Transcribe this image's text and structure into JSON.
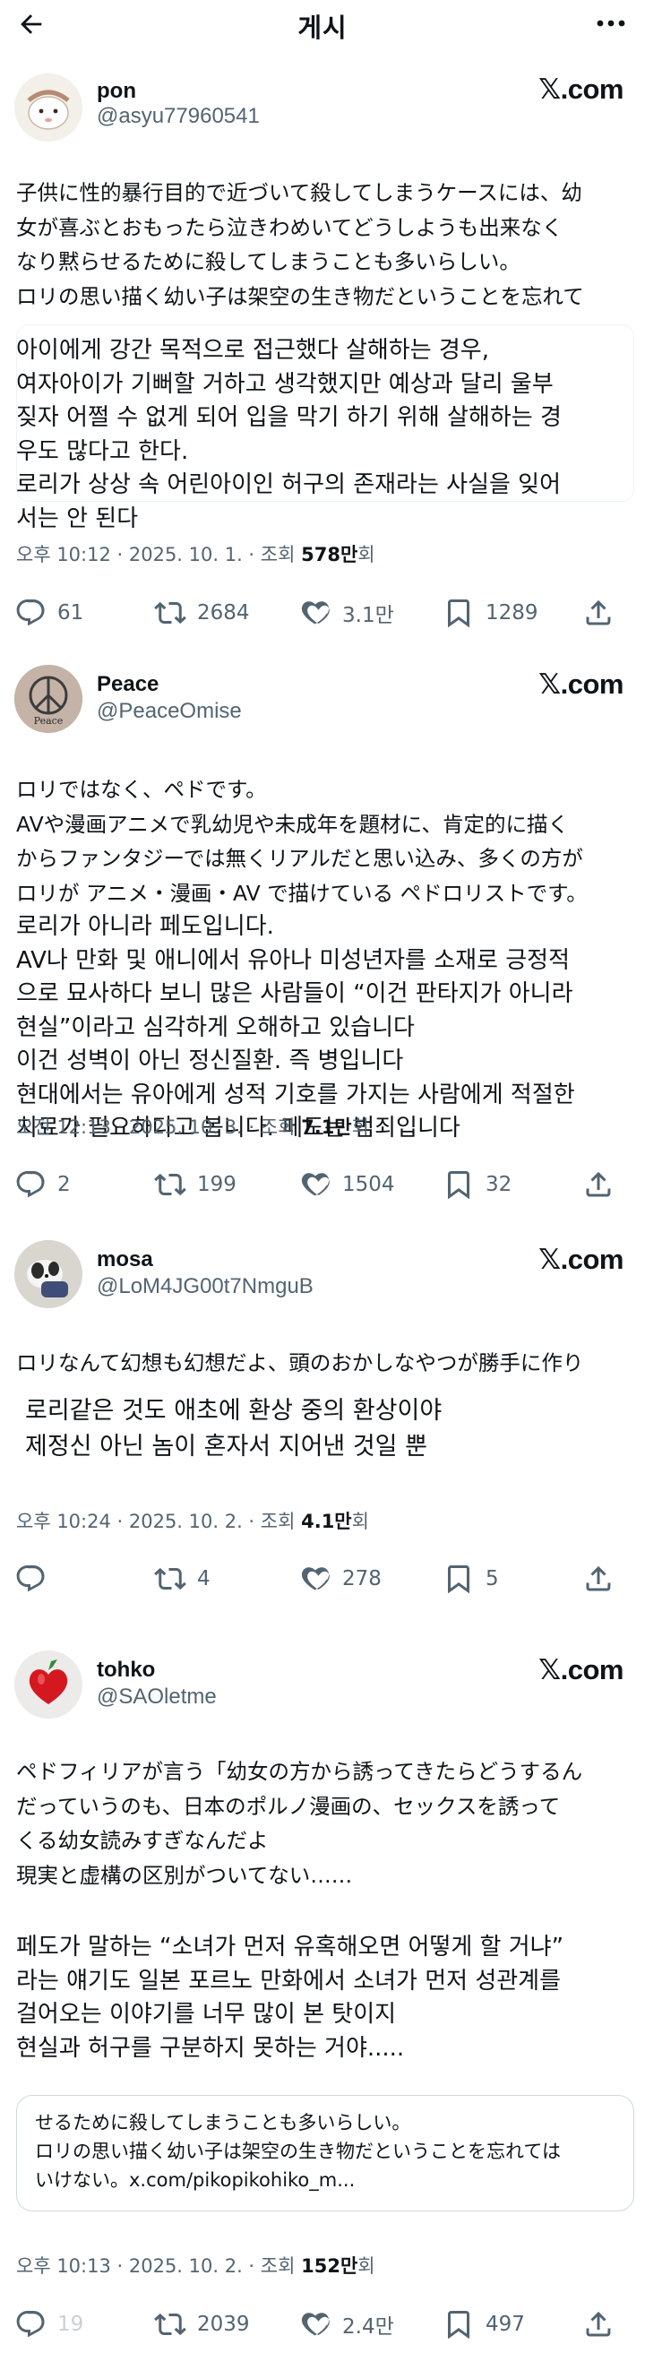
{
  "header": {
    "title": "게시"
  },
  "posts": [
    {
      "name": "pon",
      "handle": "@asyu77960541",
      "source": "𝕏.com",
      "original": "子供に性的暴行目的で近づいて殺してしまうケースには、幼\n女が喜ぶとおもったら泣きわめいてどうしようも出来なく\nなり黙らせるために殺してしまうことも多いらしい。\nロリの思い描く幼い子は架空の生き物だということを忘れて",
      "translation": "아이에게 강간 목적으로 접근했다 살해하는 경우,\n여자아이가 기뻐할 거하고 생각했지만 예상과 달리 울부\n짖자 어쩔 수 없게 되어 입을 막기 하기 위해 살해하는 경\n우도 많다고 한다.\n로리가 상상 속 어린아이인 허구의 존재라는 사실을 잊어\n서는 안 된다",
      "time": "오후 10:12 · 2025. 10. 1. · 조회 ",
      "views": "578만",
      "views_suffix": "회",
      "replies": "61",
      "reposts": "2684",
      "likes": "3.1만",
      "bookmarks": "1289"
    },
    {
      "name": "Peace",
      "handle": "@PeaceOmise",
      "source": "𝕏.com",
      "avatar_text": "Peace",
      "original": "ロリではなく、ペドです。\nAVや漫画アニメで乳幼児や未成年を題材に、肯定的に描く\nからファンタジーでは無くリアルだと思い込み、多くの方が\nロリが アニメ・漫画・AV で描けている ペドロリストです。",
      "translation": "로리가 아니라 페도입니다.\nAV나 만화 및 애니에서 유아나 미성년자를 소재로 긍정적\n으로 묘사하다 보니 많은 사람들이 “이건 판타지가 아니라\n현실”이라고 심각하게 오해하고 있습니다\n이건 성벽이 아닌 정신질환. 즉 병입니다\n현대에서는 유아에게 성적 기호를 가지는 사람에게 적절한\n치료가 필요하다고 봅니다. 페도는 범죄입니다",
      "time": "오전 12:13 · 2025. 10. 3. · 조회 ",
      "views": "7.1만",
      "views_suffix": "회",
      "replies": "2",
      "reposts": "199",
      "likes": "1504",
      "bookmarks": "32"
    },
    {
      "name": "mosa",
      "handle": "@LoM4JG00t7NmguB",
      "source": "𝕏.com",
      "original": "ロリなんて幻想も幻想だよ、頭のおかしなやつが勝手に作り",
      "translation": "로리같은 것도 애초에 환상 중의 환상이야\n제정신 아닌 놈이 혼자서 지어낸 것일 뿐",
      "time": "오후 10:24 · 2025. 10. 2. · 조회 ",
      "views": "4.1만",
      "views_suffix": "회",
      "replies": "",
      "reposts": "4",
      "likes": "278",
      "bookmarks": "5"
    },
    {
      "name": "tohko",
      "handle": "@SAOletme",
      "source": "𝕏.com",
      "original": "ペドフィリアが言う「幼女の方から誘ってきたらどうするん\nだっていうのも、日本のポルノ漫画の、セックスを誘って\nくる幼女読みすぎなんだよ\n現実と虚構の区別がついてない……",
      "translation": "페도가 말하는 “소녀가 먼저 유혹해오면 어떻게 할 거냐”\n라는 얘기도 일본 포르노 만화에서 소녀가 먼저 성관계를\n걸어오는 이야기를 너무 많이 본 탓이지\n현실과 허구를 구분하지 못하는 거야.....",
      "quote": "せるために殺してしまうことも多いらしい。\nロリの思い描く幼い子は架空の生き物だということを忘れては\nいけない。x.com/pikopikohiko_m...",
      "time": "오후 10:13 · 2025. 10. 2. · 조회 ",
      "views": "152만",
      "views_suffix": "회",
      "replies": "19",
      "reposts": "2039",
      "likes": "2.4만",
      "bookmarks": "497"
    }
  ],
  "colors": {
    "text": "#0f1419",
    "muted": "#536471",
    "border": "#eff3f4"
  },
  "icons": [
    "back-arrow-icon",
    "more-icon",
    "reply-icon",
    "repost-icon",
    "like-icon",
    "bookmark-icon",
    "share-icon"
  ]
}
